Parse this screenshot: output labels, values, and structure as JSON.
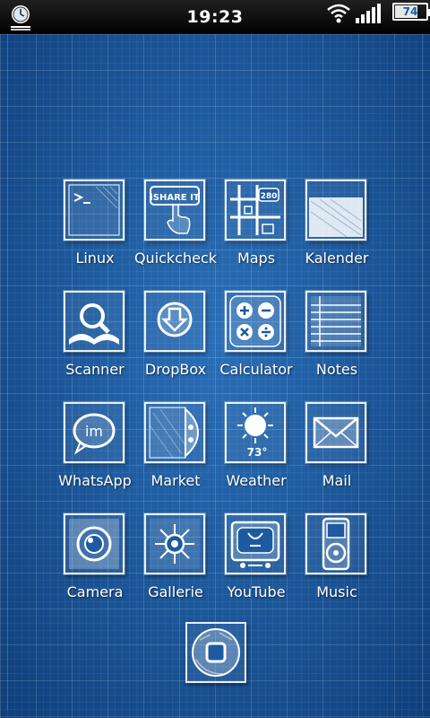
{
  "status_bar": {
    "time": "19:23",
    "battery_level": "74",
    "battery_fraction": 0.74,
    "left_icon": "clock-icon",
    "wifi_icon": "wifi-icon",
    "signal_icon": "signal-icon",
    "battery_icon": "battery-icon"
  },
  "colors": {
    "background": "#1d5a9f",
    "sketch_line": "#ffffff"
  },
  "apps": [
    {
      "label": "Linux",
      "icon": "terminal-icon"
    },
    {
      "label": "Quickcheck",
      "icon": "ishareit-icon"
    },
    {
      "label": "Maps",
      "icon": "maps-icon"
    },
    {
      "label": "Kalender",
      "icon": "calendar-icon"
    },
    {
      "label": "Scanner",
      "icon": "scanner-icon"
    },
    {
      "label": "DropBox",
      "icon": "dropbox-icon"
    },
    {
      "label": "Calculator",
      "icon": "calculator-icon"
    },
    {
      "label": "Notes",
      "icon": "notes-icon"
    },
    {
      "label": "WhatsApp",
      "icon": "whatsapp-icon"
    },
    {
      "label": "Market",
      "icon": "market-icon"
    },
    {
      "label": "Weather",
      "icon": "weather-icon"
    },
    {
      "label": "Mail",
      "icon": "mail-icon"
    },
    {
      "label": "Camera",
      "icon": "camera-icon"
    },
    {
      "label": "Gallerie",
      "icon": "gallery-icon"
    },
    {
      "label": "YouTube",
      "icon": "youtube-icon"
    },
    {
      "label": "Music",
      "icon": "music-icon"
    }
  ],
  "icon_text": {
    "ishareit": "iSHARE IT",
    "maps_sign": "280",
    "whatsapp": "im",
    "weather_temp": "73°"
  },
  "dock": {
    "icon": "home-button-icon"
  }
}
